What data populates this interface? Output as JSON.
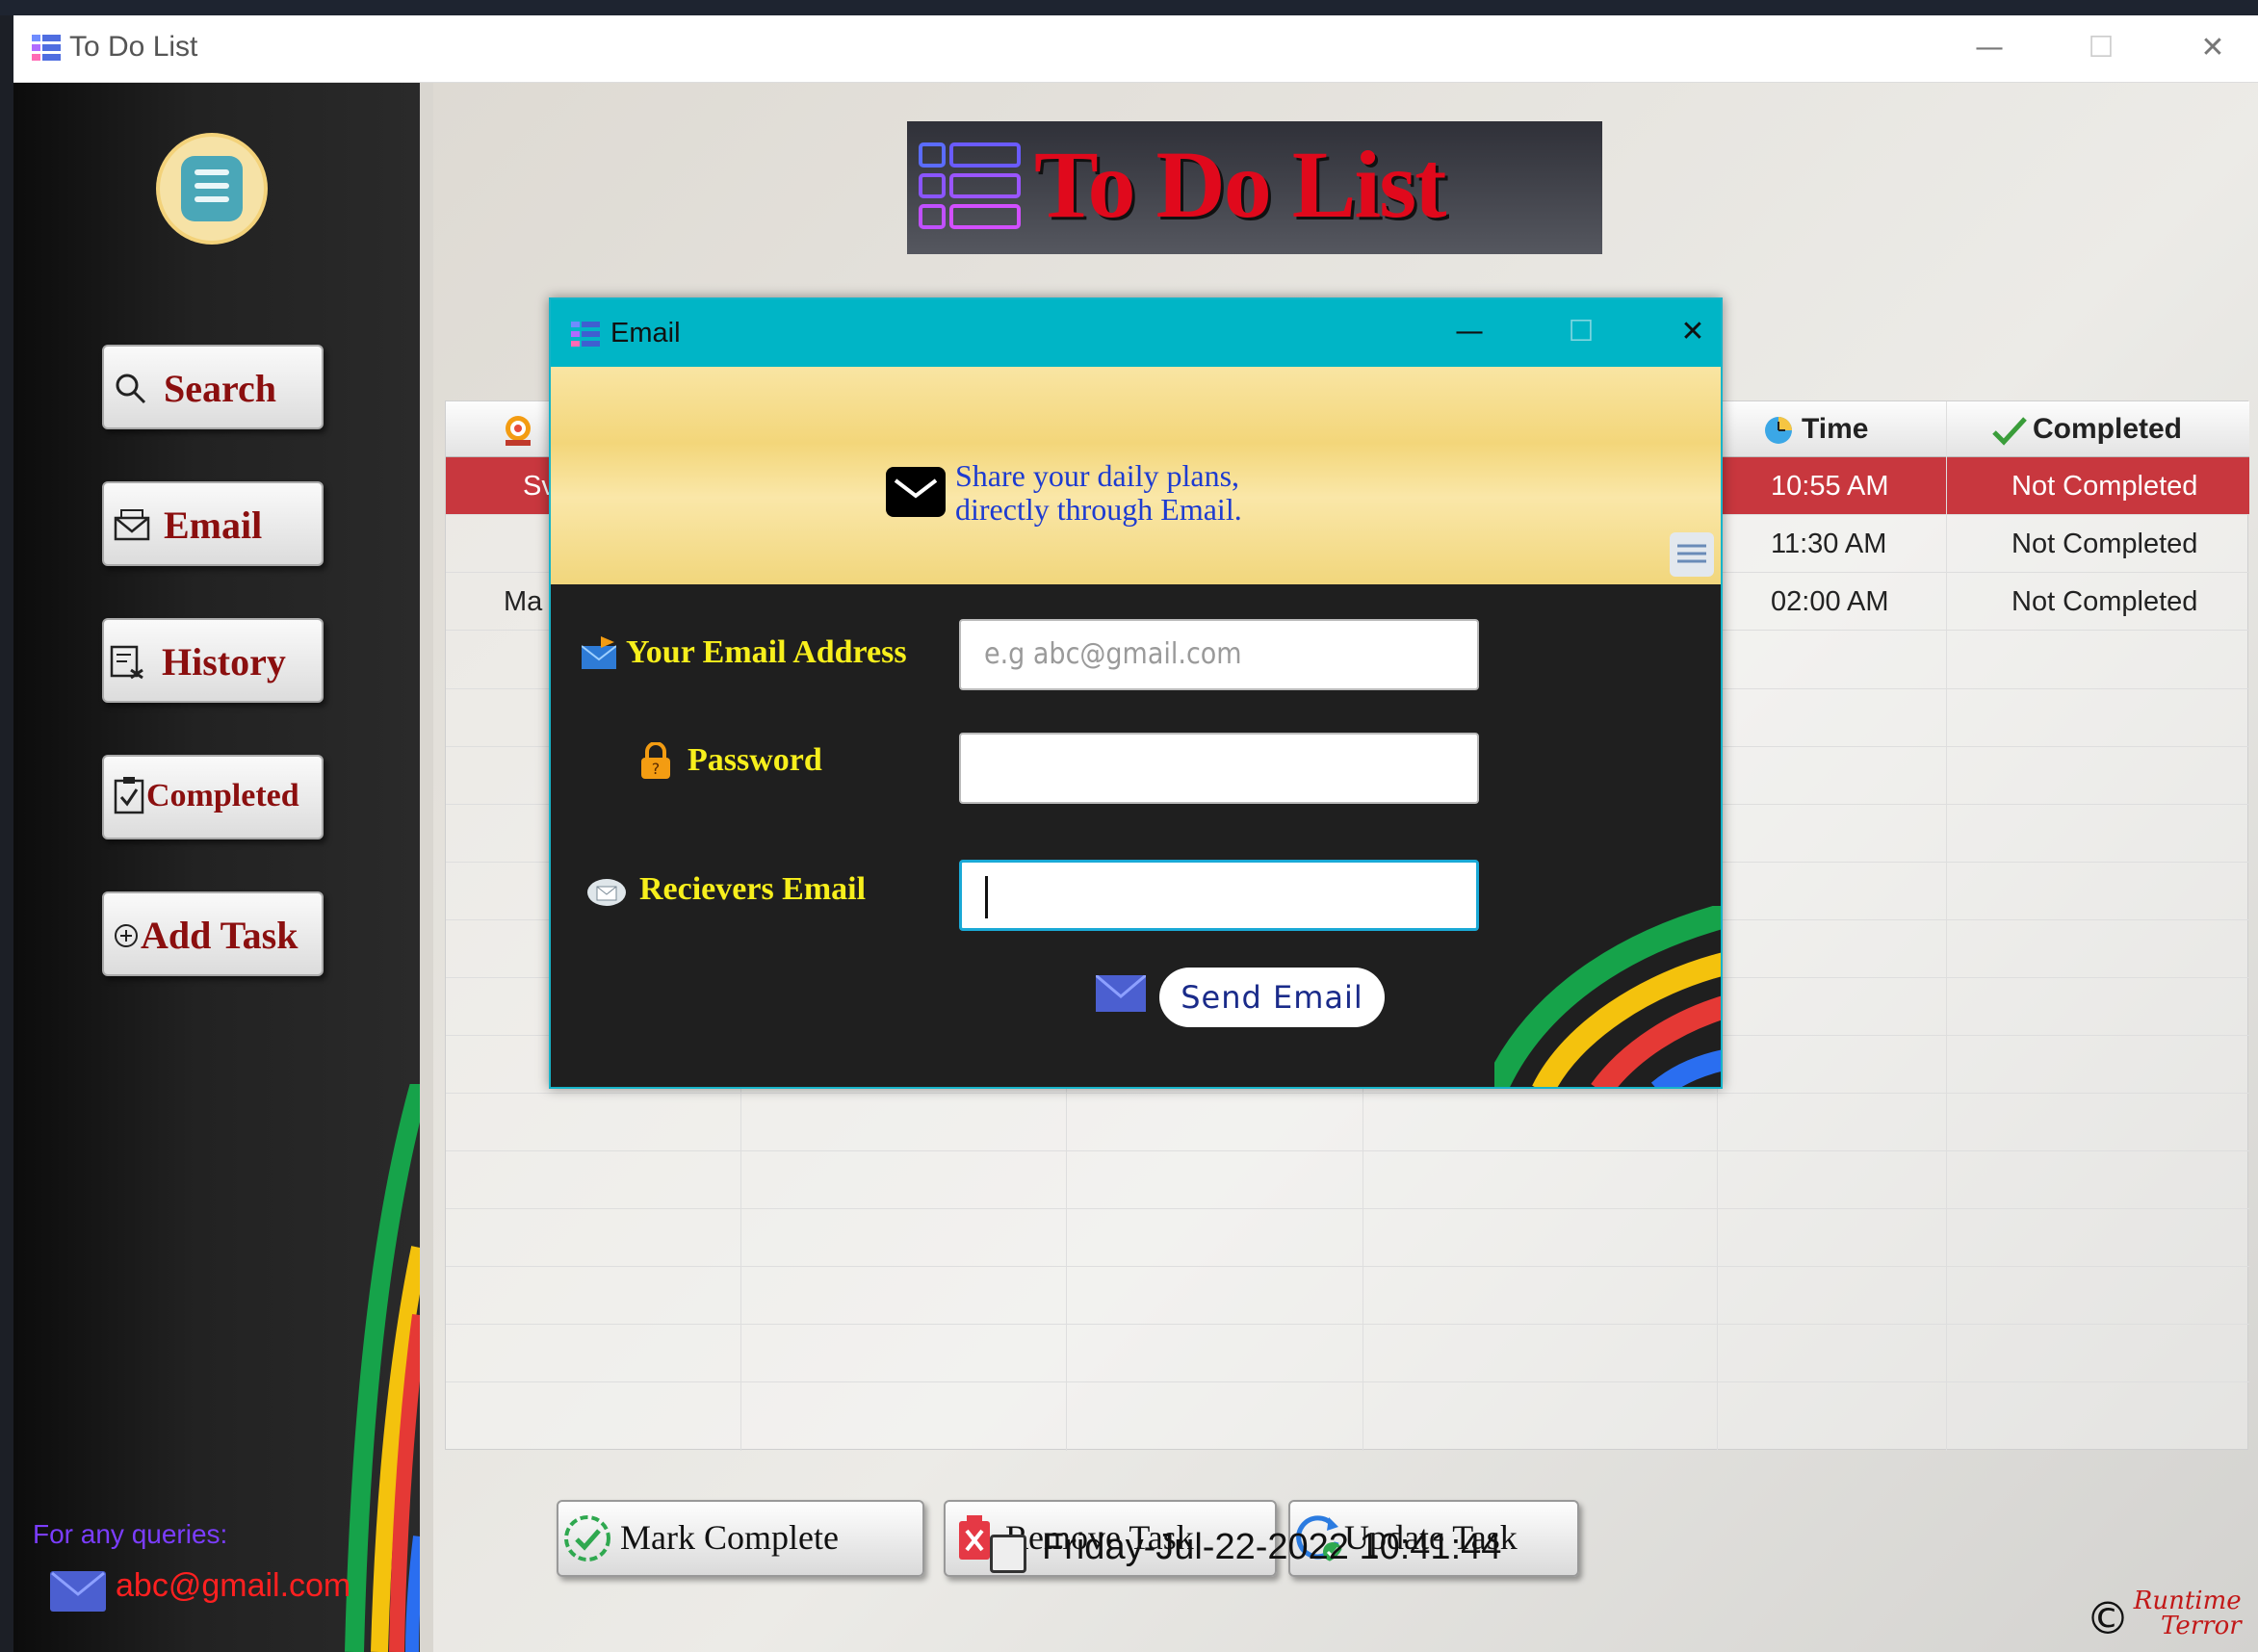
{
  "window": {
    "title": "To Do List",
    "controls": {
      "minimize": "—",
      "maximize": "☐",
      "close": "✕"
    }
  },
  "banner": {
    "title": "To Do List"
  },
  "sidebar": {
    "buttons": [
      {
        "label": "Search",
        "icon": "search-icon"
      },
      {
        "label": "Email",
        "icon": "envelope-icon"
      },
      {
        "label": "History",
        "icon": "history-icon"
      },
      {
        "label": "Completed",
        "icon": "clipboard-check-icon"
      },
      {
        "label": "Add Task",
        "icon": "plus-circle-icon"
      }
    ],
    "queries_label": "For any queries:",
    "contact_email": "abc@gmail.com"
  },
  "table": {
    "columns": [
      "",
      "Time",
      "Completed"
    ],
    "rows": [
      {
        "name": "Sv",
        "time": "10:55 AM",
        "status": "Not Completed",
        "selected": true
      },
      {
        "name": "",
        "time": "11:30 AM",
        "status": "Not Completed",
        "selected": false
      },
      {
        "name": "Ma",
        "time": "02:00 AM",
        "status": "Not Completed",
        "selected": false
      }
    ]
  },
  "actions": {
    "mark_complete": "Mark Complete",
    "remove_task": "Remove Task",
    "update_task": "Update Task"
  },
  "status": {
    "datetime": "Friday-Jul-22-2022 10:41:44",
    "copyright": "©",
    "brand_line1": "Runtime",
    "brand_line2": "Terror"
  },
  "email_dialog": {
    "title": "Email",
    "controls": {
      "minimize": "—",
      "maximize": "☐",
      "close": "✕"
    },
    "tagline_line1": "Share your daily plans,",
    "tagline_line2": "directly through Email.",
    "fields": {
      "your_email_label": "Your Email Address",
      "your_email_placeholder": "e.g  abc@gmail.com",
      "password_label": "Password",
      "receiver_label": "Recievers Email"
    },
    "send_button": "Send  Email"
  },
  "colors": {
    "accent_cyan": "#00b5c6",
    "selected_row": "#c8373e",
    "label_yellow": "#f7ef1c",
    "sidebar_text": "#8b0f0f"
  }
}
